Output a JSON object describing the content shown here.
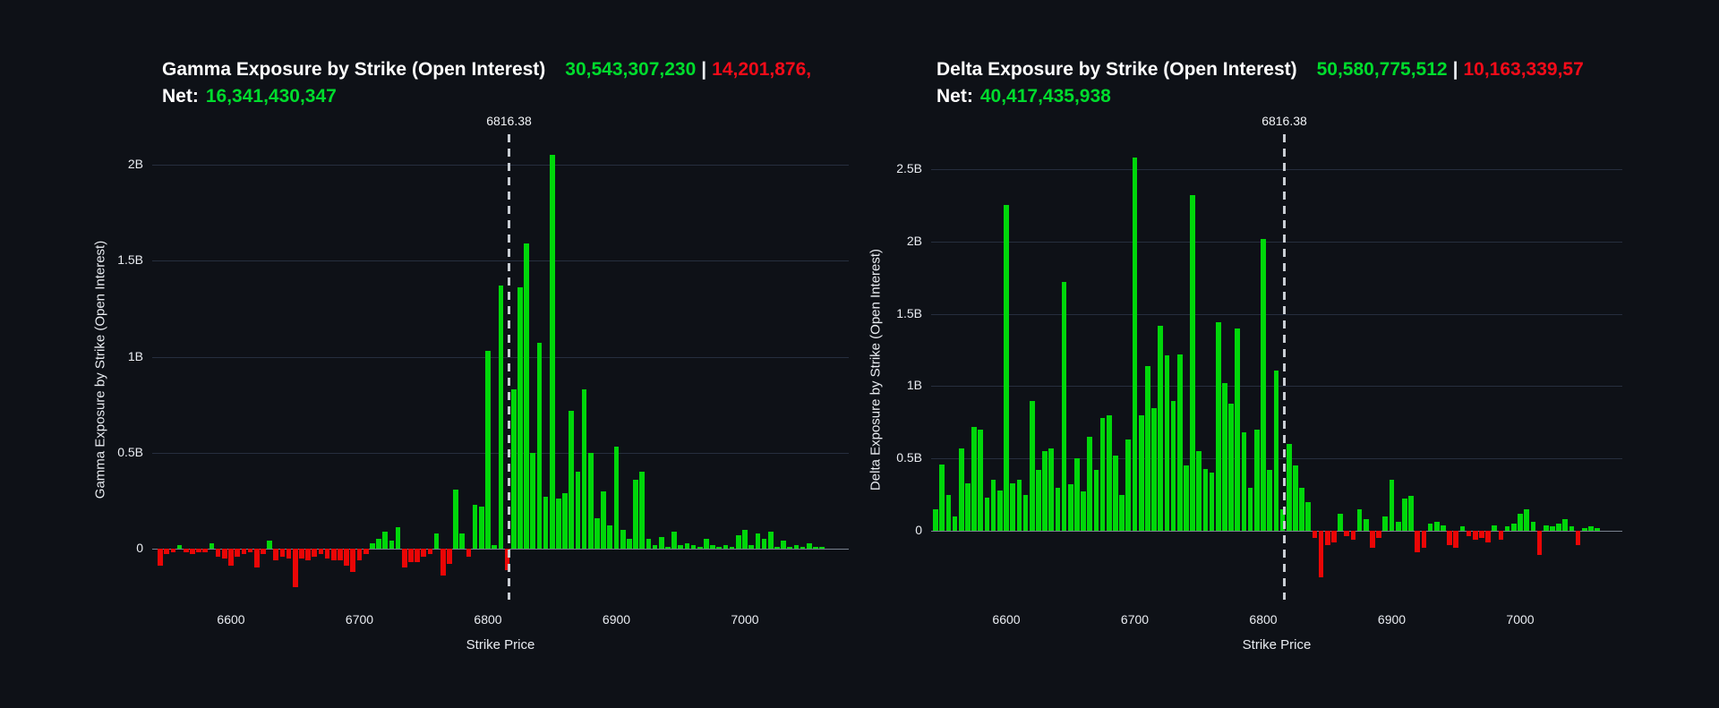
{
  "app": {
    "background_color": "#0e1117",
    "positive_color": "#00d70a",
    "negative_color": "#ea0606",
    "positive_text_color": "#00dc2d",
    "negative_text_color": "#f40b19",
    "grid_color": "#262e3e",
    "zero_line_color": "#79818f",
    "spot_line_color": "#c9ced4"
  },
  "chart_data": [
    {
      "type": "bar",
      "title": "Gamma Exposure by Strike (Open Interest)",
      "header": {
        "positive_total": "30,543,307,230",
        "pipe": "|",
        "negative_total": "14,201,876,",
        "net_label": "Net:",
        "net_value": "16,341,430,347"
      },
      "xlabel": "Strike Price",
      "ylabel": "Gamma Exposure by Strike (Open Interest)",
      "legend": "none",
      "grid": true,
      "units": "billions",
      "y_ticks": [
        "0",
        "0.5B",
        "1B",
        "1.5B",
        "2B"
      ],
      "y_tick_values": [
        0,
        0.5,
        1,
        1.5,
        2
      ],
      "x_tick_values": [
        6600,
        6700,
        6800,
        6900,
        7000
      ],
      "ylim": [
        -0.3,
        2.16
      ],
      "xlim": [
        6540,
        7072
      ],
      "spot_label": "6816.38",
      "spot_value": 6816.38,
      "x": [
        6545,
        6550,
        6555,
        6560,
        6565,
        6570,
        6575,
        6580,
        6585,
        6590,
        6595,
        6600,
        6605,
        6610,
        6615,
        6620,
        6625,
        6630,
        6635,
        6640,
        6645,
        6650,
        6655,
        6660,
        6665,
        6670,
        6675,
        6680,
        6685,
        6690,
        6695,
        6700,
        6705,
        6710,
        6715,
        6720,
        6725,
        6730,
        6735,
        6740,
        6745,
        6750,
        6755,
        6760,
        6765,
        6770,
        6775,
        6780,
        6785,
        6790,
        6795,
        6800,
        6805,
        6810,
        6815,
        6820,
        6825,
        6830,
        6835,
        6840,
        6845,
        6850,
        6855,
        6860,
        6865,
        6870,
        6875,
        6880,
        6885,
        6890,
        6895,
        6900,
        6905,
        6910,
        6915,
        6920,
        6925,
        6930,
        6935,
        6940,
        6945,
        6950,
        6955,
        6960,
        6965,
        6970,
        6975,
        6980,
        6985,
        6990,
        6995,
        7000,
        7005,
        7010,
        7015,
        7020,
        7025,
        7030,
        7035,
        7040,
        7045,
        7050,
        7055,
        7060
      ],
      "values": [
        -0.09,
        -0.03,
        -0.02,
        0.02,
        -0.02,
        -0.03,
        -0.02,
        -0.02,
        0.03,
        -0.04,
        -0.05,
        -0.09,
        -0.04,
        -0.03,
        -0.02,
        -0.1,
        -0.03,
        0.04,
        -0.06,
        -0.04,
        -0.05,
        -0.2,
        -0.05,
        -0.06,
        -0.04,
        -0.03,
        -0.05,
        -0.06,
        -0.06,
        -0.09,
        -0.12,
        -0.06,
        -0.03,
        0.03,
        0.05,
        0.09,
        0.04,
        0.11,
        -0.1,
        -0.07,
        -0.07,
        -0.04,
        -0.03,
        0.08,
        -0.14,
        -0.08,
        0.31,
        0.08,
        -0.04,
        0.23,
        0.22,
        1.03,
        0.02,
        1.37,
        -0.11,
        0.83,
        1.36,
        1.59,
        0.5,
        1.07,
        0.27,
        2.05,
        0.26,
        0.29,
        0.72,
        0.4,
        0.83,
        0.5,
        0.16,
        0.3,
        0.12,
        0.53,
        0.1,
        0.05,
        0.36,
        0.4,
        0.05,
        0.02,
        0.06,
        0.01,
        0.09,
        0.02,
        0.03,
        0.02,
        0.01,
        0.05,
        0.02,
        0.01,
        0.02,
        0.01,
        0.07,
        0.1,
        0.02,
        0.08,
        0.05,
        0.09,
        0.01,
        0.04,
        0.01,
        0.02,
        0.01,
        0.03,
        0.01,
        0.01
      ]
    },
    {
      "type": "bar",
      "title": "Delta Exposure by Strike (Open Interest)",
      "header": {
        "positive_total": "50,580,775,512",
        "pipe": "|",
        "negative_total": "10,163,339,57",
        "net_label": "Net:",
        "net_value": "40,417,435,938"
      },
      "xlabel": "Strike Price",
      "ylabel": "Delta Exposure by Strike (Open Interest)",
      "legend": "none",
      "grid": true,
      "units": "billions",
      "y_ticks": [
        "0",
        "0.5B",
        "1B",
        "1.5B",
        "2B",
        "2.5B"
      ],
      "y_tick_values": [
        0,
        0.5,
        1,
        1.5,
        2,
        2.5
      ],
      "x_tick_values": [
        6600,
        6700,
        6800,
        6900,
        7000
      ],
      "ylim": [
        -0.52,
        2.74
      ],
      "xlim": [
        6540,
        7072
      ],
      "spot_label": "6816.38",
      "spot_value": 6816.38,
      "x": [
        6545,
        6550,
        6555,
        6560,
        6565,
        6570,
        6575,
        6580,
        6585,
        6590,
        6595,
        6600,
        6605,
        6610,
        6615,
        6620,
        6625,
        6630,
        6635,
        6640,
        6645,
        6650,
        6655,
        6660,
        6665,
        6670,
        6675,
        6680,
        6685,
        6690,
        6695,
        6700,
        6705,
        6710,
        6715,
        6720,
        6725,
        6730,
        6735,
        6740,
        6745,
        6750,
        6755,
        6760,
        6765,
        6770,
        6775,
        6780,
        6785,
        6790,
        6795,
        6800,
        6805,
        6810,
        6815,
        6820,
        6825,
        6830,
        6835,
        6840,
        6845,
        6850,
        6855,
        6860,
        6865,
        6870,
        6875,
        6880,
        6885,
        6890,
        6895,
        6900,
        6905,
        6910,
        6915,
        6920,
        6925,
        6930,
        6935,
        6940,
        6945,
        6950,
        6955,
        6960,
        6965,
        6970,
        6975,
        6980,
        6985,
        6990,
        6995,
        7000,
        7005,
        7010,
        7015,
        7020,
        7025,
        7030,
        7035,
        7040,
        7045,
        7050,
        7055,
        7060
      ],
      "values": [
        0.15,
        0.46,
        0.25,
        0.1,
        0.57,
        0.33,
        0.72,
        0.7,
        0.23,
        0.35,
        0.28,
        2.25,
        0.33,
        0.35,
        0.25,
        0.9,
        0.42,
        0.55,
        0.57,
        0.3,
        1.72,
        0.32,
        0.5,
        0.27,
        0.65,
        0.42,
        0.78,
        0.8,
        0.52,
        0.25,
        0.63,
        2.58,
        0.8,
        1.14,
        0.85,
        1.42,
        1.21,
        0.9,
        1.22,
        0.45,
        2.32,
        0.55,
        0.43,
        0.4,
        1.44,
        1.02,
        0.88,
        1.4,
        0.68,
        0.3,
        0.7,
        2.02,
        0.42,
        1.11,
        0.15,
        0.6,
        0.45,
        0.3,
        0.2,
        -0.05,
        -0.32,
        -0.1,
        -0.08,
        0.12,
        -0.04,
        -0.06,
        0.15,
        0.08,
        -0.12,
        -0.05,
        0.1,
        0.35,
        0.06,
        0.22,
        0.24,
        -0.15,
        -0.12,
        0.05,
        0.06,
        0.04,
        -0.1,
        -0.12,
        0.03,
        -0.04,
        -0.06,
        -0.05,
        -0.08,
        0.04,
        -0.06,
        0.03,
        0.05,
        0.12,
        0.15,
        0.06,
        -0.17,
        0.04,
        0.03,
        0.05,
        0.08,
        0.03,
        -0.1,
        0.02,
        0.03,
        0.02
      ]
    }
  ]
}
